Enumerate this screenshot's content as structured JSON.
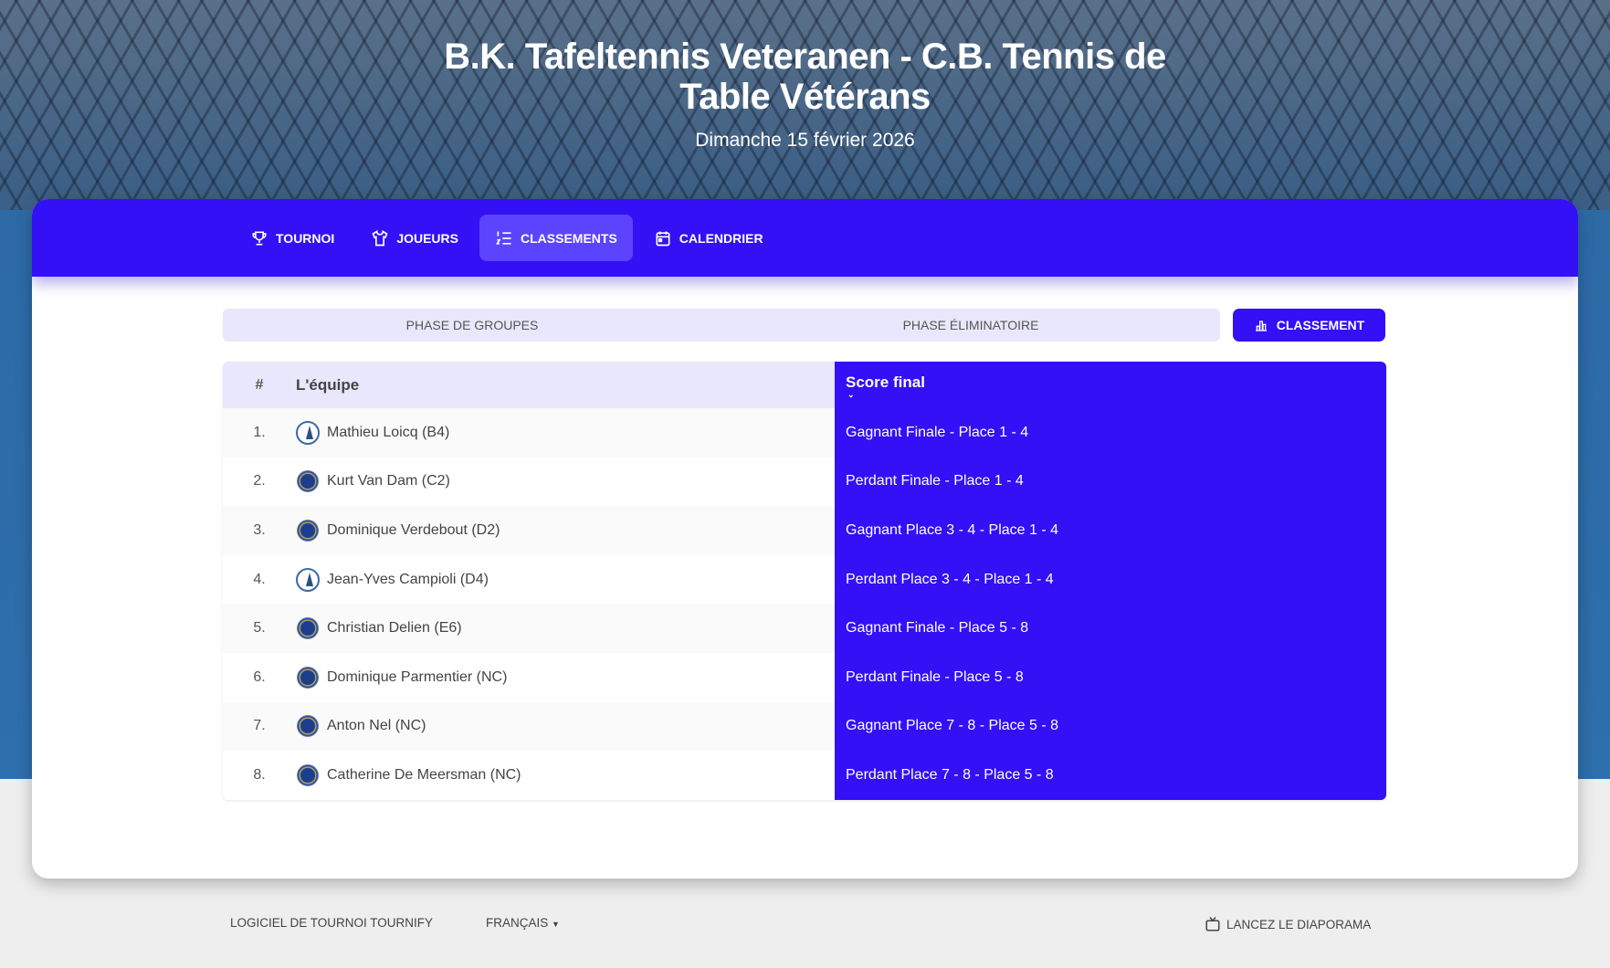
{
  "header": {
    "title": "B.K. Tafeltennis Veteranen - C.B. Tennis de Table Vétérans",
    "date": "Dimanche 15 février 2026"
  },
  "nav": [
    {
      "label": "TOURNOI",
      "icon": "trophy-icon"
    },
    {
      "label": "JOUEURS",
      "icon": "shirt-icon"
    },
    {
      "label": "CLASSEMENTS",
      "icon": "ordered-list-icon",
      "active": true
    },
    {
      "label": "CALENDRIER",
      "icon": "calendar-icon"
    }
  ],
  "phases": {
    "groups": "PHASE DE GROUPES",
    "knockout": "PHASE ÉLIMINATOIRE",
    "ranking_button": "CLASSEMENT"
  },
  "table": {
    "headers": {
      "rank": "#",
      "team": "L'équipe",
      "score": "Score final"
    },
    "rows": [
      {
        "rank": "1.",
        "team": "Mathieu Loicq (B4)",
        "score": "Gagnant Finale - Place 1 - 4",
        "club": "a"
      },
      {
        "rank": "2.",
        "team": "Kurt Van Dam (C2)",
        "score": "Perdant Finale - Place 1 - 4",
        "club": "b"
      },
      {
        "rank": "3.",
        "team": "Dominique Verdebout (D2)",
        "score": "Gagnant Place 3 - 4 - Place 1 - 4",
        "club": "b"
      },
      {
        "rank": "4.",
        "team": "Jean-Yves Campioli (D4)",
        "score": "Perdant Place 3 - 4 - Place 1 - 4",
        "club": "a"
      },
      {
        "rank": "5.",
        "team": "Christian Delien (E6)",
        "score": "Gagnant Finale - Place 5 - 8",
        "club": "b"
      },
      {
        "rank": "6.",
        "team": "Dominique Parmentier (NC)",
        "score": "Perdant Finale - Place 5 - 8",
        "club": "b"
      },
      {
        "rank": "7.",
        "team": "Anton Nel (NC)",
        "score": "Gagnant Place 7 - 8 - Place 5 - 8",
        "club": "b"
      },
      {
        "rank": "8.",
        "team": "Catherine De Meersman (NC)",
        "score": "Perdant Place 7 - 8 - Place 5 - 8",
        "club": "b"
      }
    ]
  },
  "footer": {
    "software": "LOGICIEL DE TOURNOI TOURNIFY",
    "language": "FRANÇAIS",
    "slideshow": "LANCEZ LE DIAPORAMA"
  },
  "colors": {
    "accent": "#3310f5",
    "light": "#e9e7fb"
  }
}
